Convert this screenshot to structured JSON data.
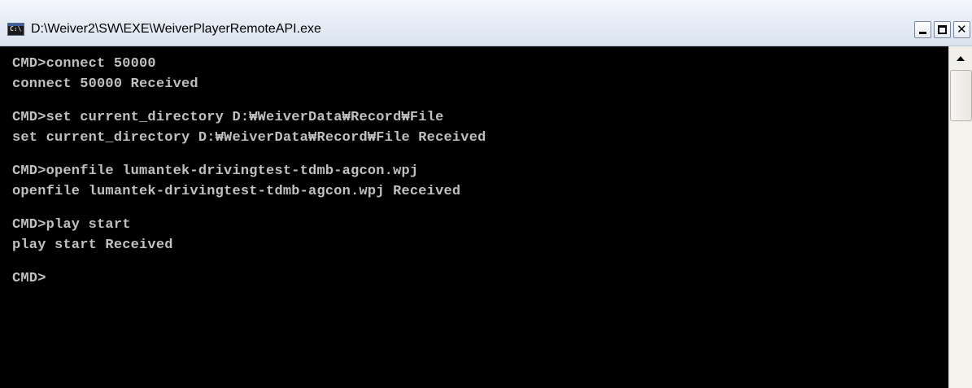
{
  "window": {
    "title": "D:\\Weiver2\\SW\\EXE\\WeiverPlayerRemoteAPI.exe",
    "icon": "console-app-icon",
    "icon_label": "C:\\",
    "buttons": {
      "minimize": "minimize-icon",
      "maximize": "maximize-icon",
      "close": "close-icon"
    }
  },
  "console": {
    "line_color": "#c0c0c0",
    "background": "#000000",
    "lines": [
      "CMD>connect 50000",
      "connect 50000 Received",
      "",
      "CMD>set current_directory D:₩WeiverData₩Record₩File",
      "set current_directory D:₩WeiverData₩Record₩File Received",
      "",
      "CMD>openfile lumantek-drivingtest-tdmb-agcon.wpj",
      "openfile lumantek-drivingtest-tdmb-agcon.wpj Received",
      "",
      "CMD>play start",
      "play start Received",
      "",
      "CMD>"
    ]
  },
  "scrollbar": {
    "up_icon": "scroll-up-arrow-icon"
  }
}
